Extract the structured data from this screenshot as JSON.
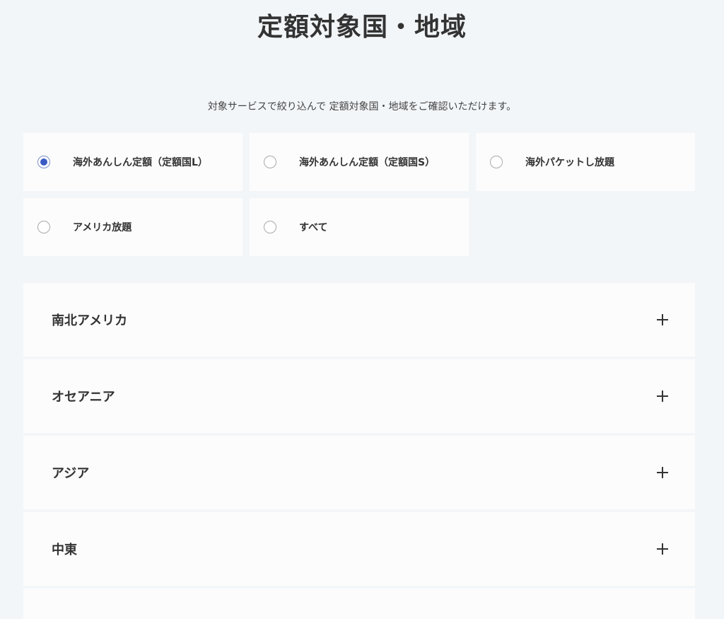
{
  "header": {
    "title": "定額対象国・地域",
    "subtitle": "対象サービスで絞り込んで 定額対象国・地域をご確認いただけます。"
  },
  "filters": {
    "options": [
      {
        "label": "海外あんしん定額（定額国L）",
        "selected": true
      },
      {
        "label": "海外あんしん定額（定額国S）",
        "selected": false
      },
      {
        "label": "海外パケットし放題",
        "selected": false
      },
      {
        "label": "アメリカ放題",
        "selected": false
      },
      {
        "label": "すべて",
        "selected": false
      }
    ]
  },
  "regions": {
    "items": [
      {
        "label": "南北アメリカ"
      },
      {
        "label": "オセアニア"
      },
      {
        "label": "アジア"
      },
      {
        "label": "中東"
      }
    ]
  },
  "colors": {
    "background": "#f3f6f9",
    "card": "#fcfcfc",
    "text": "#333333",
    "radio_selected": "#3b5bc4"
  }
}
